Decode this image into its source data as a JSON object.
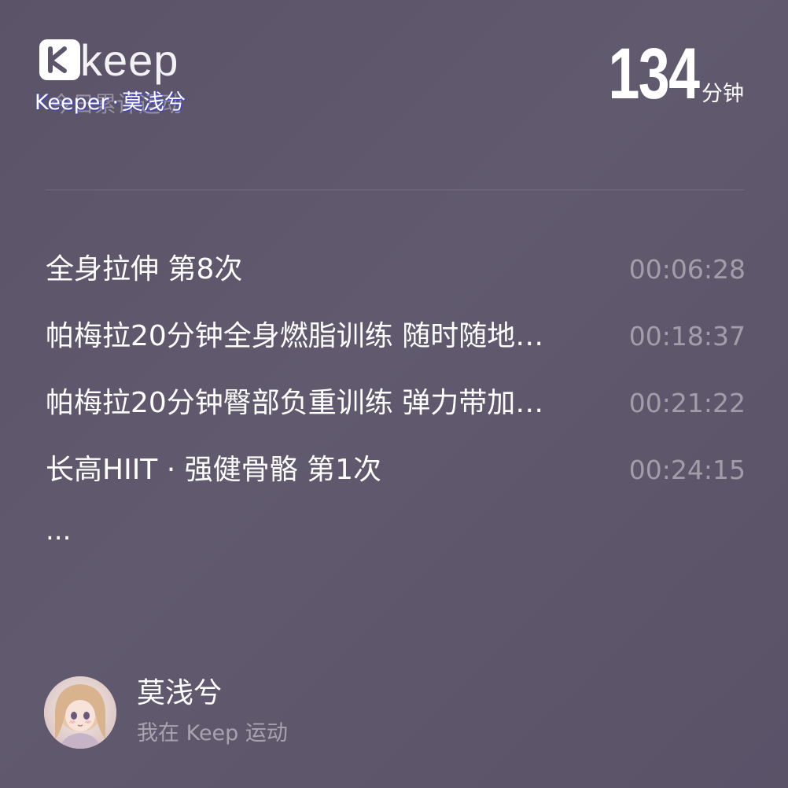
{
  "header": {
    "logo_text": "keep",
    "logo_icon": "keep-logo-icon",
    "ghost_text": "今日累计运动",
    "caption_prefix": "Keeper",
    "caption_separator": "·",
    "caption_name": "莫浅兮"
  },
  "total": {
    "value": "134",
    "unit": "分钟"
  },
  "activities": [
    {
      "title": "全身拉伸 第8次",
      "duration": "00:06:28"
    },
    {
      "title": "帕梅拉20分钟全身燃脂训练 随时随地…",
      "duration": "00:18:37"
    },
    {
      "title": "帕梅拉20分钟臀部负重训练 弹力带加…",
      "duration": "00:21:22"
    },
    {
      "title": "长高HIIT · 强健骨骼 第1次",
      "duration": "00:24:15"
    }
  ],
  "more_indicator": "...",
  "user": {
    "name": "莫浅兮",
    "subtitle": "我在 Keep 运动",
    "avatar_icon": "avatar-illustration"
  },
  "colors": {
    "background": "#5d5569",
    "text_primary": "#ffffff",
    "text_muted": "#a59fae"
  }
}
